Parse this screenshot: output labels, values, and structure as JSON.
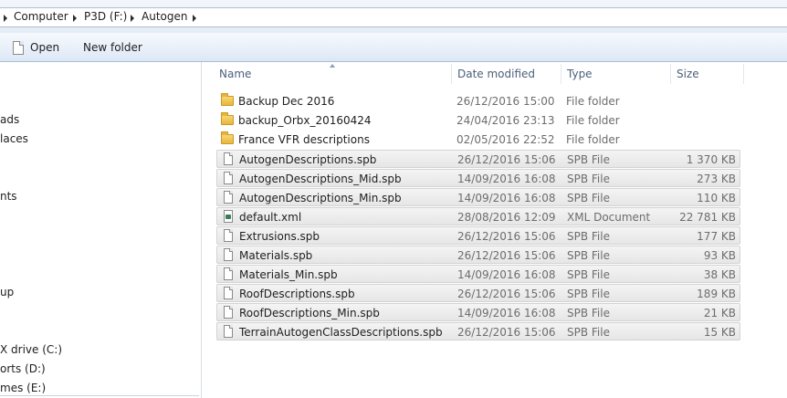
{
  "breadcrumb": [
    {
      "label": "Computer"
    },
    {
      "label": "P3D (F:)"
    },
    {
      "label": "Autogen"
    }
  ],
  "toolbar": {
    "open_label": "Open",
    "new_folder_label": "New folder"
  },
  "nav": {
    "items": [
      {
        "label": "ads"
      },
      {
        "label": "laces"
      },
      {
        "label": "nts"
      },
      {
        "label": "up"
      },
      {
        "label": "X drive (C:)"
      },
      {
        "label": "orts (D:)"
      },
      {
        "label": "mes (E:)"
      }
    ]
  },
  "columns": {
    "name": "Name",
    "date": "Date modified",
    "type": "Type",
    "size": "Size"
  },
  "files": [
    {
      "name": "Backup Dec 2016",
      "date": "26/12/2016 15:00",
      "type": "File folder",
      "size": "",
      "icon": "folder-icon",
      "selected": false
    },
    {
      "name": "backup_Orbx_20160424",
      "date": "24/04/2016 23:13",
      "type": "File folder",
      "size": "",
      "icon": "folder-icon",
      "selected": false
    },
    {
      "name": "France VFR descriptions",
      "date": "02/05/2016 22:52",
      "type": "File folder",
      "size": "",
      "icon": "folder-icon",
      "selected": false
    },
    {
      "name": "AutogenDescriptions.spb",
      "date": "26/12/2016 15:06",
      "type": "SPB File",
      "size": "1 370 KB",
      "icon": "file-icon",
      "selected": true
    },
    {
      "name": "AutogenDescriptions_Mid.spb",
      "date": "14/09/2016 16:08",
      "type": "SPB File",
      "size": "273 KB",
      "icon": "file-icon",
      "selected": true
    },
    {
      "name": "AutogenDescriptions_Min.spb",
      "date": "14/09/2016 16:08",
      "type": "SPB File",
      "size": "110 KB",
      "icon": "file-icon",
      "selected": true
    },
    {
      "name": "default.xml",
      "date": "28/08/2016 12:09",
      "type": "XML Document",
      "size": "22 781 KB",
      "icon": "xml-icon",
      "selected": true
    },
    {
      "name": "Extrusions.spb",
      "date": "26/12/2016 15:06",
      "type": "SPB File",
      "size": "177 KB",
      "icon": "file-icon",
      "selected": true
    },
    {
      "name": "Materials.spb",
      "date": "26/12/2016 15:06",
      "type": "SPB File",
      "size": "93 KB",
      "icon": "file-icon",
      "selected": true
    },
    {
      "name": "Materials_Min.spb",
      "date": "14/09/2016 16:08",
      "type": "SPB File",
      "size": "38 KB",
      "icon": "file-icon",
      "selected": true
    },
    {
      "name": "RoofDescriptions.spb",
      "date": "26/12/2016 15:06",
      "type": "SPB File",
      "size": "189 KB",
      "icon": "file-icon",
      "selected": true
    },
    {
      "name": "RoofDescriptions_Min.spb",
      "date": "14/09/2016 16:08",
      "type": "SPB File",
      "size": "21 KB",
      "icon": "file-icon",
      "selected": true
    },
    {
      "name": "TerrainAutogenClassDescriptions.spb",
      "date": "26/12/2016 15:06",
      "type": "SPB File",
      "size": "15 KB",
      "icon": "file-icon",
      "selected": true
    }
  ]
}
